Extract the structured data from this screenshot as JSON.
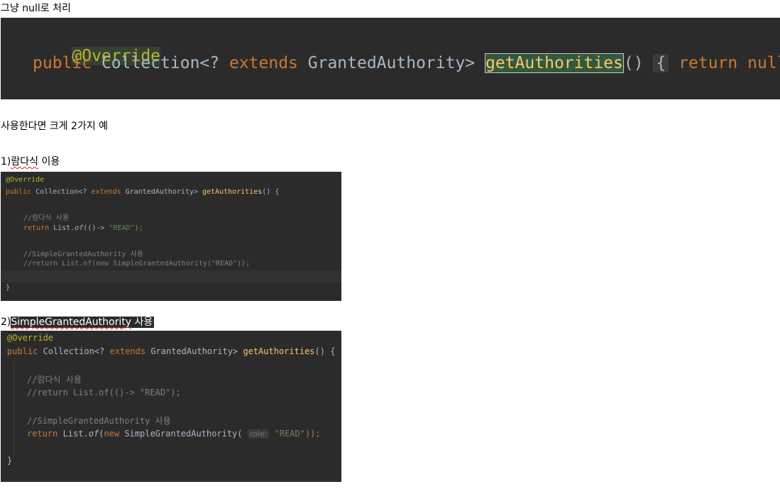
{
  "notes": {
    "null_note": "그냥 null로 처리",
    "two_examples": "사용한다면 크게 2가지 예",
    "example1_prefix": "1)",
    "example1_label": "람다식",
    "example1_suffix": " 이용",
    "example2_prefix": "2)",
    "example2_label": "SimpleGrantedAuthority",
    "example2_suffix": " 사용"
  },
  "code_null": {
    "annotation": "@Override",
    "kw_public": "public",
    "type_collection": "Collection<? ",
    "kw_extends": "extends",
    "type_granted": " GrantedAuthority> ",
    "method": "getAuthorities",
    "parens": "()",
    "open_brace": "{",
    "kw_return": "return",
    "kw_null": "null;",
    "close_brace": "}"
  },
  "code_lambda": {
    "annotation": "@Override",
    "kw_public": "public",
    "type_collection": " Collection<? ",
    "kw_extends": "extends",
    "type_granted": " GrantedAuthority> ",
    "method": "getAuthorities",
    "signature_tail": "() {",
    "comment_lambda": "//람다식 사용",
    "kw_return": "return",
    "list_prefix": " List.",
    "list_of": "of",
    "lambda_mid": "(()-> ",
    "string_read": "\"READ\"",
    "lambda_end": ");",
    "comment_sga": "//SimpleGrantedAuthority 사용",
    "comment_return": "//return List.of(new SimpleGrantedAuthority(\"READ\"));",
    "close_brace": "}"
  },
  "code_sga": {
    "annotation": "@Override",
    "kw_public": "public",
    "type_collection": " Collection<? ",
    "kw_extends": "extends",
    "type_granted": " GrantedAuthority> ",
    "method": "getAuthorities",
    "signature_tail": "() {",
    "comment_lambda": "//람다식 사용",
    "comment_return": "//return List.of(()-> \"READ\");",
    "comment_sga": "//SimpleGrantedAuthority 사용",
    "kw_return": "return",
    "list_prefix": " List.",
    "list_of": "of",
    "paren_open": "(",
    "kw_new": "new",
    "ctor": " SimpleGrantedAuthority(",
    "param_hint": "role:",
    "string_read": "\"READ\"",
    "call_end": "));",
    "close_brace": "}"
  }
}
